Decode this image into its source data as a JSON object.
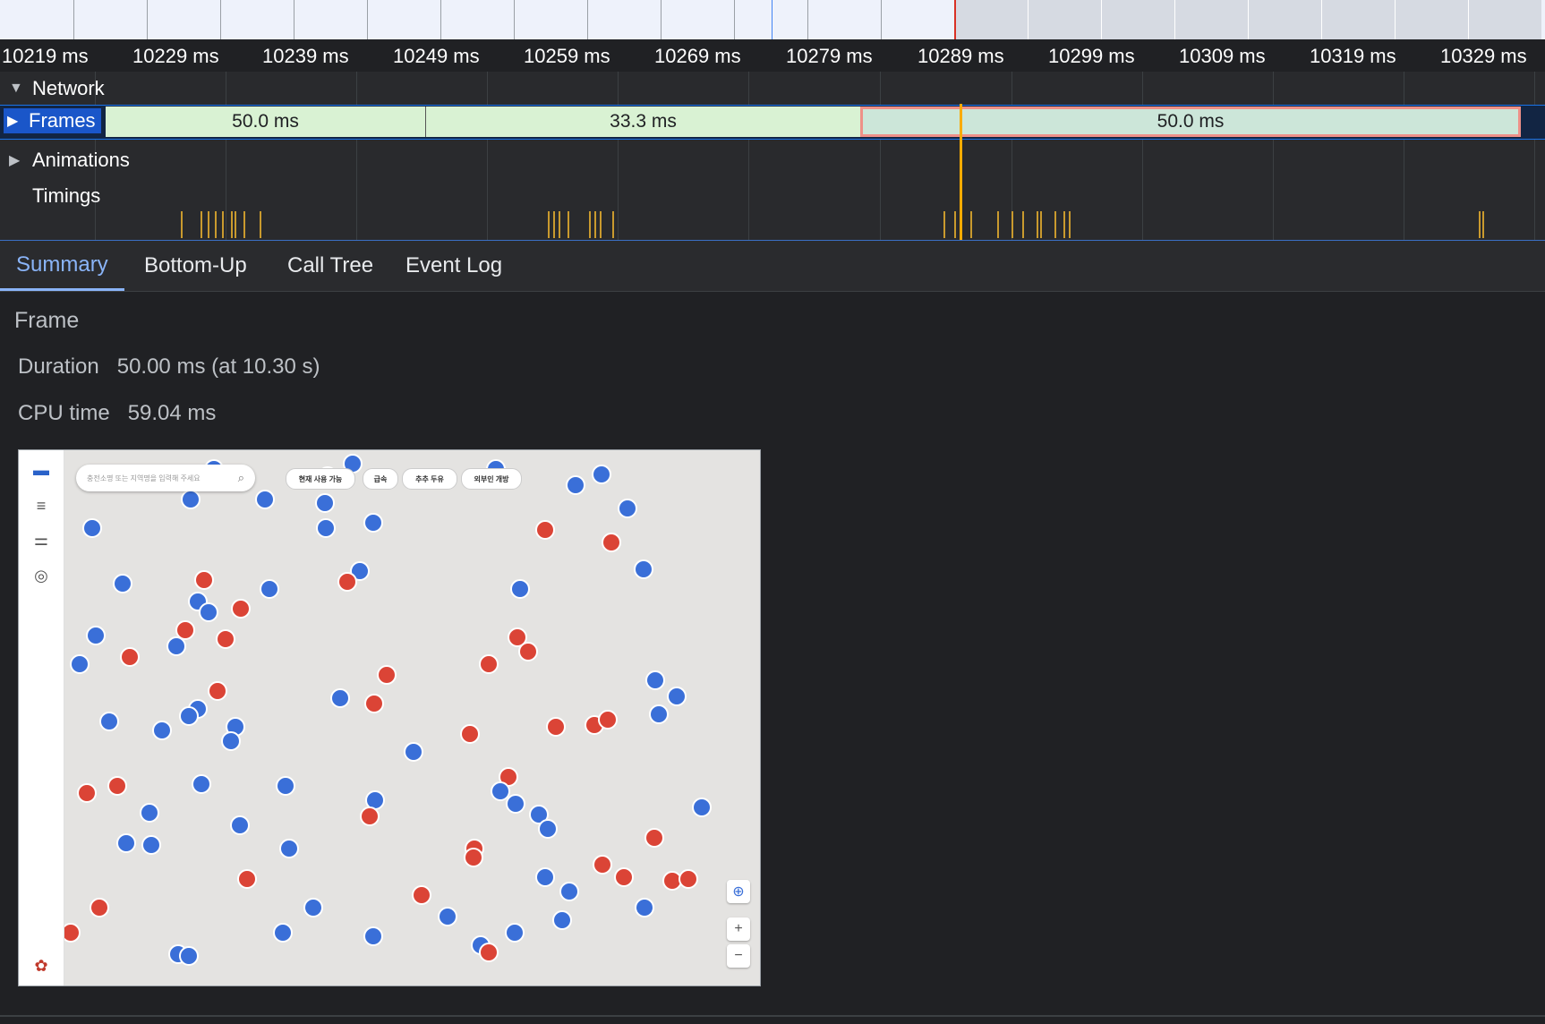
{
  "timeline": {
    "tick_labels": [
      "10219 ms",
      "10229 ms",
      "10239 ms",
      "10249 ms",
      "10259 ms",
      "10269 ms",
      "10279 ms",
      "10289 ms",
      "10299 ms",
      "10309 ms",
      "10319 ms",
      "10329 ms"
    ],
    "tracks": {
      "network": "Network",
      "frames": "Frames",
      "animations": "Animations",
      "timings": "Timings"
    },
    "frames": [
      "50.0 ms",
      "33.3 ms",
      "50.0 ms"
    ]
  },
  "tabs": [
    "Summary",
    "Bottom-Up",
    "Call Tree",
    "Event Log"
  ],
  "summary": {
    "title": "Frame",
    "duration_label": "Duration",
    "duration_value": "50.00 ms (at 10.30 s)",
    "cpu_label": "CPU time",
    "cpu_value": "59.04 ms"
  },
  "screenshot": {
    "search_placeholder": "충전소명 또는 지역명을 입력해 주세요",
    "chips": [
      "현재 사용 가능",
      "급속",
      "추추 두유",
      "외부인 개방"
    ],
    "colors": {
      "blue_marker": "#3a6fd8",
      "red_marker": "#db4436"
    }
  }
}
